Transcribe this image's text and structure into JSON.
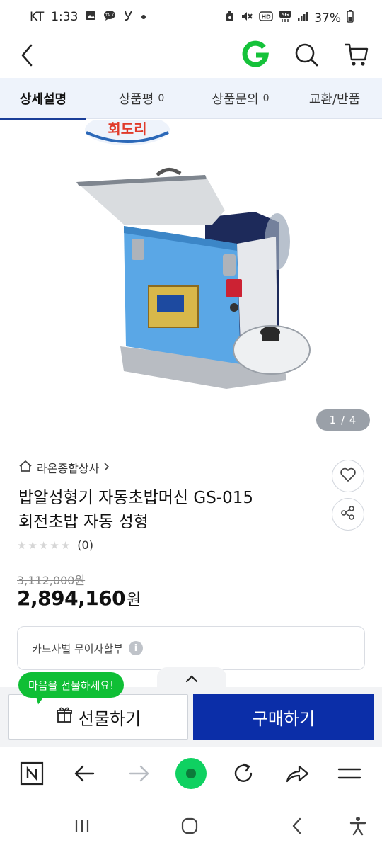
{
  "status_bar": {
    "carrier": "KT",
    "time": "1:33",
    "battery": "37%",
    "icons": [
      "image-icon",
      "talk-icon",
      "y-icon",
      "dot-icon",
      "alarm-icon",
      "mute-icon",
      "hd-icon",
      "5g-icon",
      "signal-icon",
      "battery-icon"
    ]
  },
  "app_bar": {
    "logo": "G",
    "logo_color": "#15c23a",
    "icons": [
      "back-icon",
      "search-icon",
      "cart-icon"
    ]
  },
  "tabs": [
    {
      "label": "상세설명",
      "count": ""
    },
    {
      "label": "상품평",
      "count": "0"
    },
    {
      "label": "상품문의",
      "count": "0"
    },
    {
      "label": "교환/반품",
      "count": ""
    }
  ],
  "image": {
    "brand_mark": "회도리",
    "pager": "1 / 4"
  },
  "product": {
    "seller": "라온종합상사",
    "title_line1": "밥알성형기 자동초밥머신 GS-015",
    "title_line2": "회전초밥 자동 성형",
    "rating": 0,
    "rating_max": 5,
    "review_count": "(0)",
    "original_price": "3,112,000원",
    "price": "2,894,160",
    "price_unit": "원",
    "card_installment": "카드사별 무이자할부"
  },
  "purchase": {
    "gift_bubble": "마음을 선물하세요!",
    "gift_label": "선물하기",
    "buy_label": "구매하기",
    "buy_color": "#0b2ea8"
  },
  "browser_bar": {
    "icons": [
      "naver-icon",
      "back-arrow-icon",
      "forward-arrow-icon",
      "home-green-icon",
      "refresh-icon",
      "share-icon",
      "menu-icon"
    ]
  },
  "system_nav": {
    "icons": [
      "recents-icon",
      "home-icon",
      "back-icon",
      "accessibility-icon"
    ]
  }
}
